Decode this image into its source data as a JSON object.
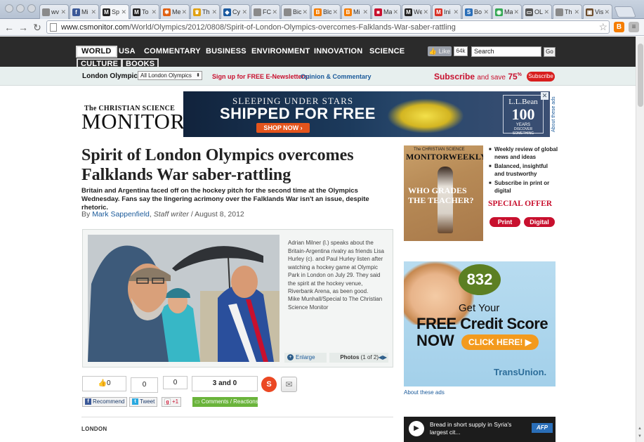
{
  "browser": {
    "tabs": [
      {
        "label": "wv",
        "icon": "page-icon",
        "color": "#8a8a8a"
      },
      {
        "label": "Mi",
        "icon": "facebook-icon",
        "color": "#3b5998"
      },
      {
        "label": "Sp",
        "icon": "csmonitor-icon",
        "color": "#222222",
        "active": true
      },
      {
        "label": "To",
        "icon": "csmonitor-icon",
        "color": "#222222"
      },
      {
        "label": "Me",
        "icon": "puzzle-icon",
        "color": "#e06010"
      },
      {
        "label": "Th",
        "icon": "trophy-icon",
        "color": "#e0a010"
      },
      {
        "label": "Cy",
        "icon": "shield-icon",
        "color": "#1a5aa0"
      },
      {
        "label": "FC",
        "icon": "page-icon",
        "color": "#8a8a8a"
      },
      {
        "label": "Bic",
        "icon": "page-icon",
        "color": "#8a8a8a"
      },
      {
        "label": "Blo",
        "icon": "blogger-icon",
        "color": "#f57d00"
      },
      {
        "label": "Mi",
        "icon": "blogger-icon",
        "color": "#f57d00"
      },
      {
        "label": "Ma",
        "icon": "flag-icon",
        "color": "#c8102e"
      },
      {
        "label": "We",
        "icon": "csmonitor-icon",
        "color": "#222222"
      },
      {
        "label": "Ini",
        "icon": "gmail-icon",
        "color": "#d93025"
      },
      {
        "label": "Bo",
        "icon": "sr-icon",
        "color": "#2a6eb8"
      },
      {
        "label": "Ma",
        "icon": "maps-icon",
        "color": "#34a853"
      },
      {
        "label": "OL",
        "icon": "chat-icon",
        "color": "#555555"
      },
      {
        "label": "Th",
        "icon": "page-icon",
        "color": "#8a8a8a"
      },
      {
        "label": "Vis",
        "icon": "image-icon",
        "color": "#6a4a2a"
      }
    ],
    "tab_glyphs": {
      "page-icon": "",
      "facebook-icon": "f",
      "csmonitor-icon": "M",
      "puzzle-icon": "✱",
      "trophy-icon": "♛",
      "shield-icon": "◆",
      "blogger-icon": "B",
      "flag-icon": "■",
      "gmail-icon": "M",
      "sr-icon": "S",
      "maps-icon": "◉",
      "chat-icon": "▭",
      "image-icon": "▣"
    },
    "url_host": "www.csmonitor.com",
    "url_path": "/World/Olympics/2012/0808/Spirit-of-London-Olympics-overcomes-Falklands-War-saber-rattling"
  },
  "nav": {
    "items": [
      "WORLD",
      "USA",
      "COMMENTARY",
      "BUSINESS",
      "ENVIRONMENT",
      "INNOVATION",
      "SCIENCE",
      "CULTURE",
      "BOOKS"
    ],
    "like_label": "Like",
    "like_count": "64k",
    "search_value": "Search",
    "go_label": "Go"
  },
  "subnav": {
    "section": "London Olympics",
    "select_value": "All London Olympics",
    "signup_text": "Sign up for FREE E-Newsletters:",
    "signup_link": "Opinion & Commentary",
    "subscribe_text": "Subscribe",
    "and_save": "and save",
    "percent": "75",
    "percent_sign": "%",
    "subscribe_btn": "Subscribe"
  },
  "logo": {
    "line1": "The CHRISTIAN SCIENCE",
    "line2": "MONITOR"
  },
  "banner_ad": {
    "line1": "SLEEPING UNDER STARS",
    "line2": "SHIPPED FOR FREE",
    "button": "SHOP NOW ›",
    "brand": "L.L.Bean",
    "years": "100",
    "years_label": "YEARS",
    "tagline": "DISCOVER SOMETHING",
    "close": "✕",
    "about": "About these ads"
  },
  "article": {
    "headline": "Spirit of London Olympics overcomes Falklands War saber-rattling",
    "dek": "Britain and Argentina faced off on the hockey pitch for the second time at the Olympics Wednesday. Fans say the lingering acrimony over the Falklands War isn't an issue, despite rhetoric.",
    "by": "By",
    "author": "Mark Sappenfield",
    "role": "Staff writer",
    "date": "August 8, 2012",
    "caption": "Adrian Milner (l.) speaks about the Britain-Argentina rivalry as friends Lisa Hurley (c). and Paul Hurley listen after watching a hockey game at Olympic Park in London on July 29. They said the spirit at the hockey venue, Riverbank Arena, as been good.",
    "credit": "Mike Munhall/Special to The Christian Science Monitor",
    "enlarge": "Enlarge",
    "photos_label": "Photos",
    "photos_count": "(1 of 2)",
    "dateline": "LONDON"
  },
  "social": {
    "fb_count": "0",
    "tw_count": "0",
    "gplus_count": "0",
    "total": "3 and 0",
    "recommend": "Recommend",
    "tweet": "Tweet",
    "plus_one": "+1",
    "comments": "Comments / Reactions"
  },
  "rail": {
    "weekly_small": "The CHRISTIAN SCIENCE",
    "weekly_big": "MONITORWEEKLY",
    "weekly_q1": "WHO GRADES",
    "weekly_q2": "THE TEACHER?",
    "bullets": [
      "Weekly review of global news and ideas",
      "Balanced, insightful and trustworthy",
      "Subscribe in print or digital"
    ],
    "special": "SPECIAL OFFER",
    "print": "Print",
    "digital": "Digital",
    "credit_ad": {
      "score": "832",
      "t1": "Get Your",
      "t2": "FREE Credit Score",
      "t3": "NOW",
      "cta": "CLICK HERE!",
      "brand": "TransUnion."
    },
    "about_ads": "About these ads",
    "video_text": "Bread in short supply in Syria's largest cit...",
    "video_brand": "AFP"
  },
  "colors": {
    "accent_red": "#c8102e",
    "link_blue": "#1a5a9a",
    "nav_bg": "#2b2b2b"
  }
}
